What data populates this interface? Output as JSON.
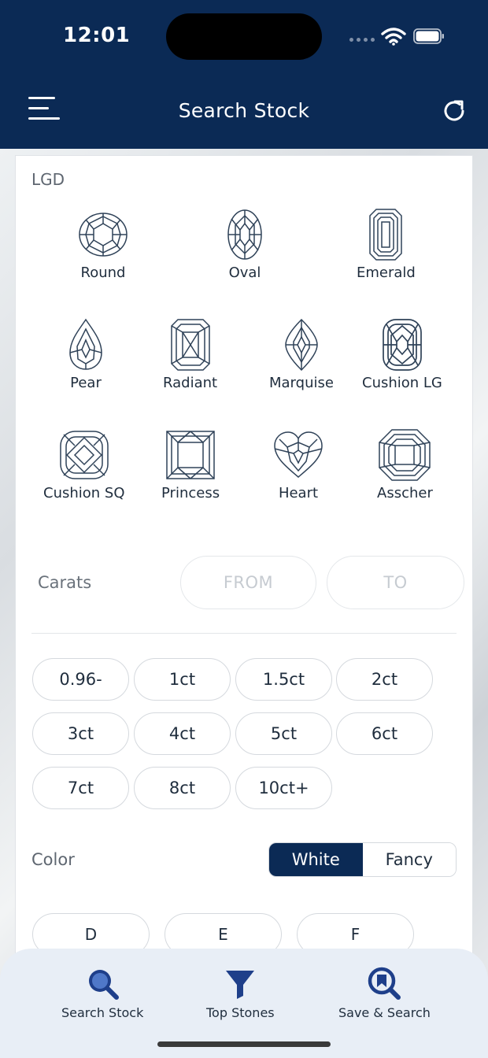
{
  "status_bar": {
    "time": "12:01"
  },
  "header": {
    "title": "Search Stock"
  },
  "section": {
    "label": "LGD"
  },
  "shapes": [
    {
      "name": "Round",
      "icon": "round-diamond-icon"
    },
    {
      "name": "Oval",
      "icon": "oval-diamond-icon"
    },
    {
      "name": "Emerald",
      "icon": "emerald-diamond-icon"
    },
    {
      "name": "Pear",
      "icon": "pear-diamond-icon"
    },
    {
      "name": "Radiant",
      "icon": "radiant-diamond-icon"
    },
    {
      "name": "Marquise",
      "icon": "marquise-diamond-icon"
    },
    {
      "name": "Cushion LG",
      "icon": "cushion-lg-diamond-icon"
    },
    {
      "name": "Cushion SQ",
      "icon": "cushion-sq-diamond-icon"
    },
    {
      "name": "Princess",
      "icon": "princess-diamond-icon"
    },
    {
      "name": "Heart",
      "icon": "heart-diamond-icon"
    },
    {
      "name": "Asscher",
      "icon": "asscher-diamond-icon"
    }
  ],
  "carats": {
    "label": "Carats",
    "from_placeholder": "FROM",
    "to_placeholder": "TO",
    "chips": [
      "0.96-",
      "1ct",
      "1.5ct",
      "2ct",
      "3ct",
      "4ct",
      "5ct",
      "6ct",
      "7ct",
      "8ct",
      "10ct+"
    ]
  },
  "color": {
    "label": "Color",
    "toggle": {
      "selected": "White",
      "other": "Fancy"
    },
    "chips": [
      "D",
      "E",
      "F"
    ]
  },
  "tabbar": [
    {
      "label": "Search Stock",
      "icon": "search-icon"
    },
    {
      "label": "Top Stones",
      "icon": "filter-icon"
    },
    {
      "label": "Save & Search",
      "icon": "saved-search-icon"
    }
  ],
  "colors": {
    "brand": "#0b2a55",
    "tabbar_bg": "#e8eef6",
    "icon_blue": "#1e3f8a"
  }
}
